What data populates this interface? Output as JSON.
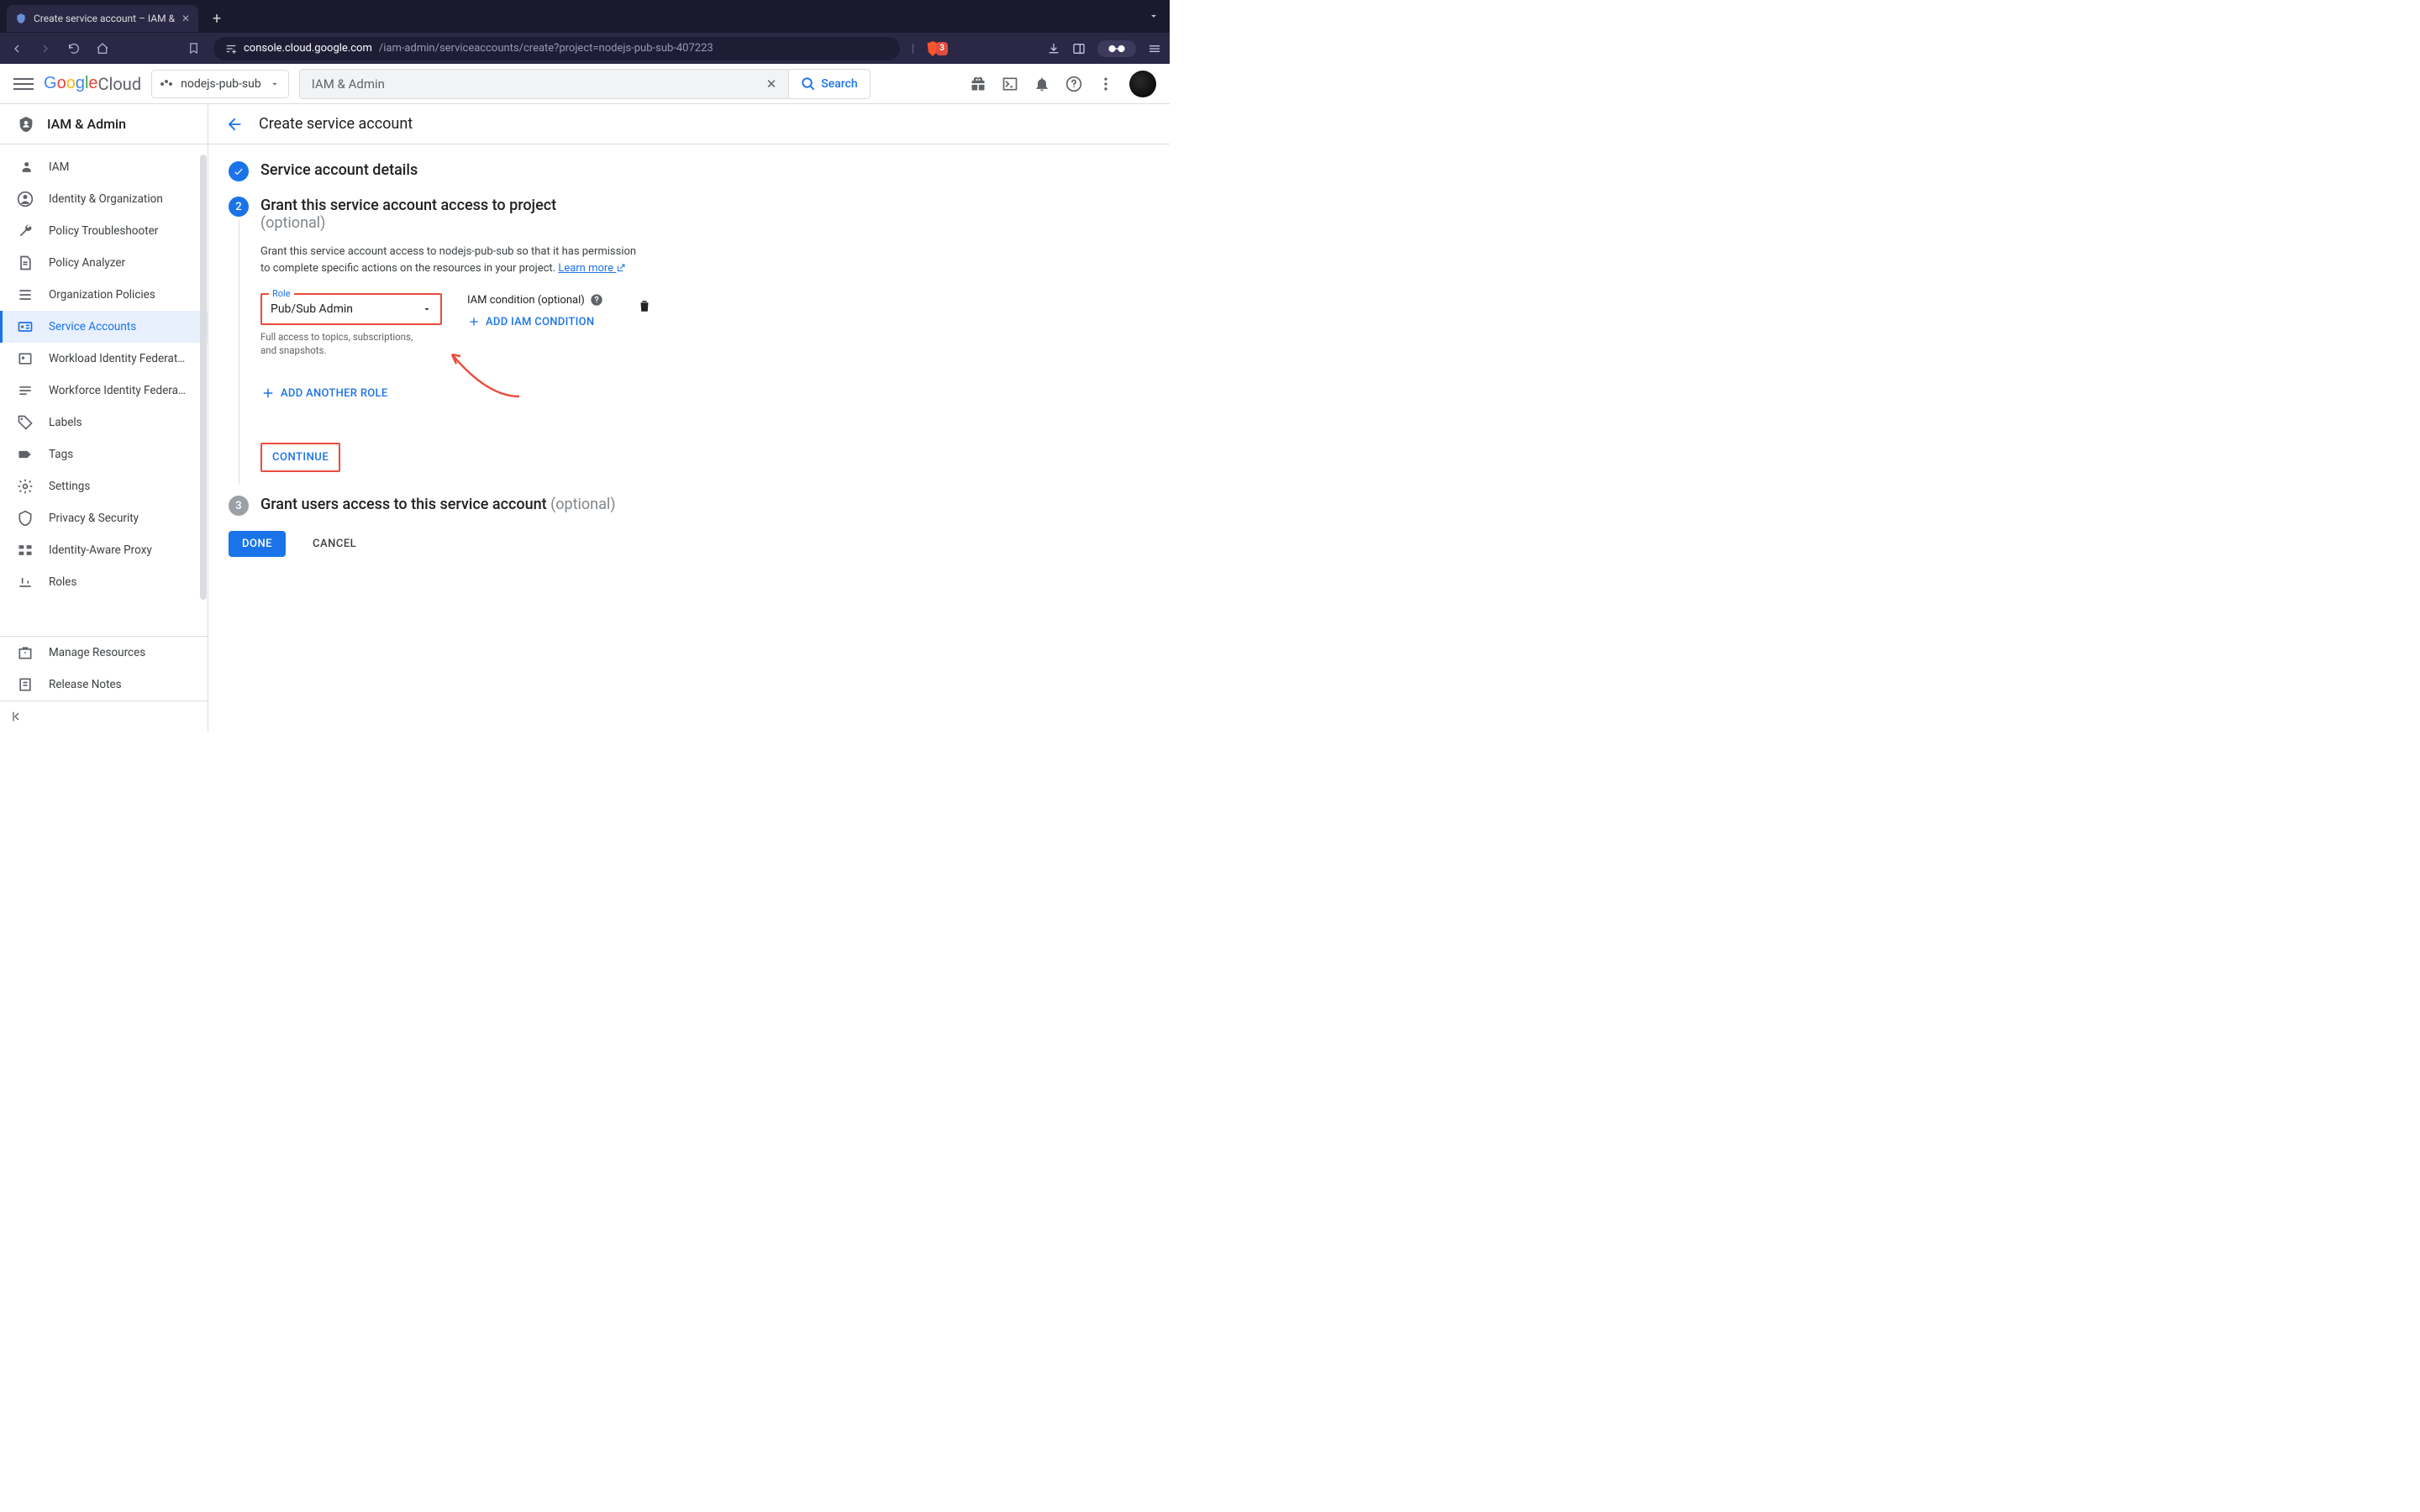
{
  "browser": {
    "tab_title": "Create service account – IAM &",
    "url_host": "console.cloud.google.com",
    "url_path": "/iam-admin/serviceaccounts/create?project=nodejs-pub-sub-407223",
    "shield_count": "3"
  },
  "header": {
    "logo_suffix": " Cloud",
    "project": "nodejs-pub-sub",
    "search_value": "IAM & Admin",
    "search_button": "Search"
  },
  "sidebar": {
    "title": "IAM & Admin",
    "items": [
      {
        "label": "IAM"
      },
      {
        "label": "Identity & Organization"
      },
      {
        "label": "Policy Troubleshooter"
      },
      {
        "label": "Policy Analyzer"
      },
      {
        "label": "Organization Policies"
      },
      {
        "label": "Service Accounts"
      },
      {
        "label": "Workload Identity Federat…"
      },
      {
        "label": "Workforce Identity Federa…"
      },
      {
        "label": "Labels"
      },
      {
        "label": "Tags"
      },
      {
        "label": "Settings"
      },
      {
        "label": "Privacy & Security"
      },
      {
        "label": "Identity-Aware Proxy"
      },
      {
        "label": "Roles"
      }
    ],
    "footer": [
      {
        "label": "Manage Resources"
      },
      {
        "label": "Release Notes"
      }
    ]
  },
  "page": {
    "title": "Create service account",
    "step1_title": "Service account details",
    "step2_title": "Grant this service account access to project",
    "step2_opt": "(optional)",
    "step2_desc_a": "Grant this service account access to nodejs-pub-sub so that it has permission to complete specific actions on the resources in your project. ",
    "step2_learn": "Learn more",
    "role_label": "Role",
    "role_value": "Pub/Sub Admin",
    "role_hint": "Full access to topics, subscriptions, and snapshots.",
    "iam_label": "IAM condition (optional)",
    "add_iam": "ADD IAM CONDITION",
    "add_role": "ADD ANOTHER ROLE",
    "continue": "CONTINUE",
    "step3_title": "Grant users access to this service account ",
    "step3_opt": "(optional)",
    "done": "DONE",
    "cancel": "CANCEL"
  }
}
